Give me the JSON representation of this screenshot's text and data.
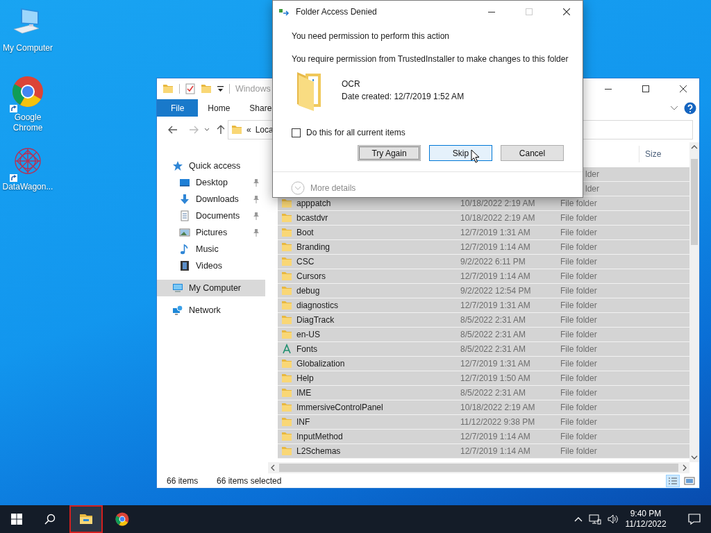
{
  "desktop_icons": [
    {
      "label": "My Computer",
      "kind": "computer",
      "shortcut": false
    },
    {
      "label": "Google Chrome",
      "kind": "chrome",
      "shortcut": true
    },
    {
      "label": "DataWagon...",
      "kind": "datawagon",
      "shortcut": true
    }
  ],
  "explorer": {
    "title": "Windows",
    "ribbon_tabs": [
      {
        "label": "File",
        "selected": true
      },
      {
        "label": "Home",
        "selected": false
      },
      {
        "label": "Share",
        "selected": false
      }
    ],
    "address": {
      "separator": "«",
      "text": "Loca"
    },
    "nav": [
      {
        "label": "Quick access",
        "kind": "star",
        "selected": false,
        "children": [
          {
            "label": "Desktop",
            "kind": "desktop",
            "pinned": true,
            "selected": false
          },
          {
            "label": "Downloads",
            "kind": "download",
            "pinned": true,
            "selected": false
          },
          {
            "label": "Documents",
            "kind": "documents",
            "pinned": true,
            "selected": false
          },
          {
            "label": "Pictures",
            "kind": "pictures",
            "pinned": true,
            "selected": false
          },
          {
            "label": "Music",
            "kind": "music",
            "pinned": false,
            "selected": false
          },
          {
            "label": "Videos",
            "kind": "videos",
            "pinned": false,
            "selected": false
          }
        ]
      },
      {
        "label": "My Computer",
        "kind": "computer",
        "selected": true
      },
      {
        "label": "Network",
        "kind": "network",
        "selected": false
      }
    ],
    "columns": [
      "Size"
    ],
    "rows": [
      {
        "type": "lder",
        "selected": true
      },
      {
        "type": "lder",
        "selected": true
      },
      {
        "name": "apppatch",
        "date": "10/18/2022 2:19 AM",
        "type": "File folder",
        "kind": "folder",
        "selected": true
      },
      {
        "name": "bcastdvr",
        "date": "10/18/2022 2:19 AM",
        "type": "File folder",
        "kind": "folder",
        "selected": true
      },
      {
        "name": "Boot",
        "date": "12/7/2019 1:31 AM",
        "type": "File folder",
        "kind": "folder",
        "selected": true
      },
      {
        "name": "Branding",
        "date": "12/7/2019 1:14 AM",
        "type": "File folder",
        "kind": "folder",
        "selected": true
      },
      {
        "name": "CSC",
        "date": "9/2/2022 6:11 PM",
        "type": "File folder",
        "kind": "folder",
        "selected": true
      },
      {
        "name": "Cursors",
        "date": "12/7/2019 1:14 AM",
        "type": "File folder",
        "kind": "folder",
        "selected": true
      },
      {
        "name": "debug",
        "date": "9/2/2022 12:54 PM",
        "type": "File folder",
        "kind": "folder",
        "selected": true
      },
      {
        "name": "diagnostics",
        "date": "12/7/2019 1:31 AM",
        "type": "File folder",
        "kind": "folder",
        "selected": true
      },
      {
        "name": "DiagTrack",
        "date": "8/5/2022 2:31 AM",
        "type": "File folder",
        "kind": "folder",
        "selected": true
      },
      {
        "name": "en-US",
        "date": "8/5/2022 2:31 AM",
        "type": "File folder",
        "kind": "folder",
        "selected": true
      },
      {
        "name": "Fonts",
        "date": "8/5/2022 2:31 AM",
        "type": "File folder",
        "kind": "fonts",
        "selected": true
      },
      {
        "name": "Globalization",
        "date": "12/7/2019 1:31 AM",
        "type": "File folder",
        "kind": "folder",
        "selected": true
      },
      {
        "name": "Help",
        "date": "12/7/2019 1:50 AM",
        "type": "File folder",
        "kind": "folder",
        "selected": true
      },
      {
        "name": "IME",
        "date": "8/5/2022 2:31 AM",
        "type": "File folder",
        "kind": "folder",
        "selected": true
      },
      {
        "name": "ImmersiveControlPanel",
        "date": "10/18/2022 2:19 AM",
        "type": "File folder",
        "kind": "folder",
        "selected": true
      },
      {
        "name": "INF",
        "date": "11/12/2022 9:38 PM",
        "type": "File folder",
        "kind": "folder",
        "selected": true
      },
      {
        "name": "InputMethod",
        "date": "12/7/2019 1:14 AM",
        "type": "File folder",
        "kind": "folder",
        "selected": true
      },
      {
        "name": "L2Schemas",
        "date": "12/7/2019 1:14 AM",
        "type": "File folder",
        "kind": "folder",
        "selected": true
      }
    ],
    "status": {
      "count": "66 items",
      "selection": "66 items selected"
    }
  },
  "dialog": {
    "title": "Folder Access Denied",
    "message": "You need permission to perform this action",
    "detail": "You require permission from TrustedInstaller to make changes to this folder",
    "item": {
      "name": "OCR",
      "date": "Date created: 12/7/2019 1:52 AM"
    },
    "checkbox": {
      "label": "Do this for all current items",
      "checked": false
    },
    "buttons": [
      {
        "label": "Try Again",
        "focused": true,
        "hovered": false
      },
      {
        "label": "Skip",
        "focused": false,
        "hovered": true
      },
      {
        "label": "Cancel",
        "focused": false,
        "hovered": false
      }
    ],
    "more_details": {
      "label": "More details",
      "disabled": true
    }
  },
  "taskbar": {
    "apps": [
      {
        "kind": "explorer",
        "active": true
      },
      {
        "kind": "chrome",
        "active": false
      }
    ],
    "time": "9:40 PM",
    "date": "11/12/2022"
  }
}
